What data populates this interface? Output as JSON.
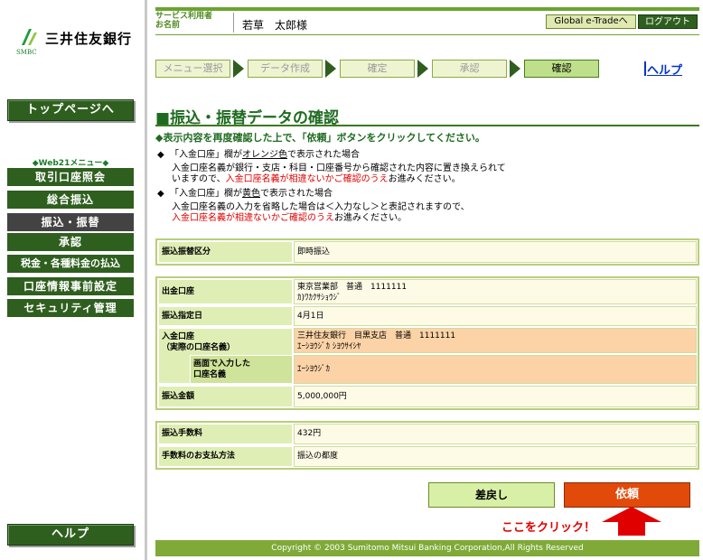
{
  "logo": {
    "name": "三井住友銀行",
    "sub": "SMBC"
  },
  "sidebar": {
    "top_page": "トップページへ",
    "web21_label": "◆Web21メニュー◆",
    "items": [
      {
        "label": "取引口座照会"
      },
      {
        "label": "総合振込"
      },
      {
        "label": "振込・振替"
      },
      {
        "label": "承認"
      },
      {
        "label": "税金・各種料金の払込"
      },
      {
        "label": "口座情報事前設定"
      },
      {
        "label": "セキュリティ管理"
      }
    ],
    "help": "ヘルプ"
  },
  "header": {
    "service_label_1": "サービス利用者",
    "service_label_2": "お名前",
    "username": "若草　太郎様",
    "global_button": "Global e-Tradeへ",
    "logout_button": "ログアウト"
  },
  "steps": [
    {
      "label": "メニュー選択"
    },
    {
      "label": "データ作成"
    },
    {
      "label": "確定"
    },
    {
      "label": "承認"
    },
    {
      "label": "確認"
    }
  ],
  "help_link": "ヘルプ",
  "title": "■振込・振替データの確認",
  "instruction": "◆表示内容を再度確認した上で、「依頼」ボタンをクリックしてください。",
  "notes": {
    "n1_bullet": "◆",
    "n1_line1_a": "「入金口座」欄が",
    "n1_line1_b": "オレンジ色",
    "n1_line1_c": "で表示された場合",
    "n1_line2": "入金口座名義が銀行・支店・科目・口座番号から確認された内容に置き換えられて",
    "n1_line3_a": "いますので、",
    "n1_line3_b": "入金口座名義が相違ないかご確認のうえ",
    "n1_line3_c": "お進みください。",
    "n2_bullet": "◆",
    "n2_line1_a": "「入金口座」欄が",
    "n2_line1_b": "黄色",
    "n2_line1_c": "で表示された場合",
    "n2_line2": "入金口座名義の入力を省略した場合は＜入力なし＞と表記されますので、",
    "n2_line3_a": "入金口座名義が相違ないかご確認のうえ",
    "n2_line3_b": "お進みください。"
  },
  "table1": {
    "label": "振込振替区分",
    "value": "即時振込"
  },
  "table2": {
    "from_label": "出金口座",
    "from_value_1": "東京営業部　普通　1111111",
    "from_value_2": "ｶ)ﾜｶｸｻｼｮｳｼﾞ",
    "date_label": "振込指定日",
    "date_value": "4月1日",
    "to_label_1": "入金口座",
    "to_label_2": "（実際の口座名義）",
    "to_value_1": "三井住友銀行　目黒支店　普通　1111111",
    "to_value_2": "ｴｰｼﾖｳｼﾞｶ ｼﾖｳｻｲｼﾔ",
    "input_label_1": "画面で入力した",
    "input_label_2": "口座名義",
    "input_value": "ｴｰｼﾖｳｼﾞｶ",
    "amount_label": "振込金額",
    "amount_value": "5,000,000円"
  },
  "table3": {
    "fee_label": "振込手数料",
    "fee_value": "432円",
    "method_label": "手数料のお支払方法",
    "method_value": "振込の都度"
  },
  "buttons": {
    "back": "差戻し",
    "request": "依頼"
  },
  "click_note": "ここをクリック！",
  "footer": "Copyright © 2003 Sumitomo Mitsui Banking Corporation,All Rights Reserved",
  "colors": {
    "accent_green": "#2f5f1f",
    "request_orange": "#e24a0a",
    "orange_highlight": "#fbd3a7"
  }
}
